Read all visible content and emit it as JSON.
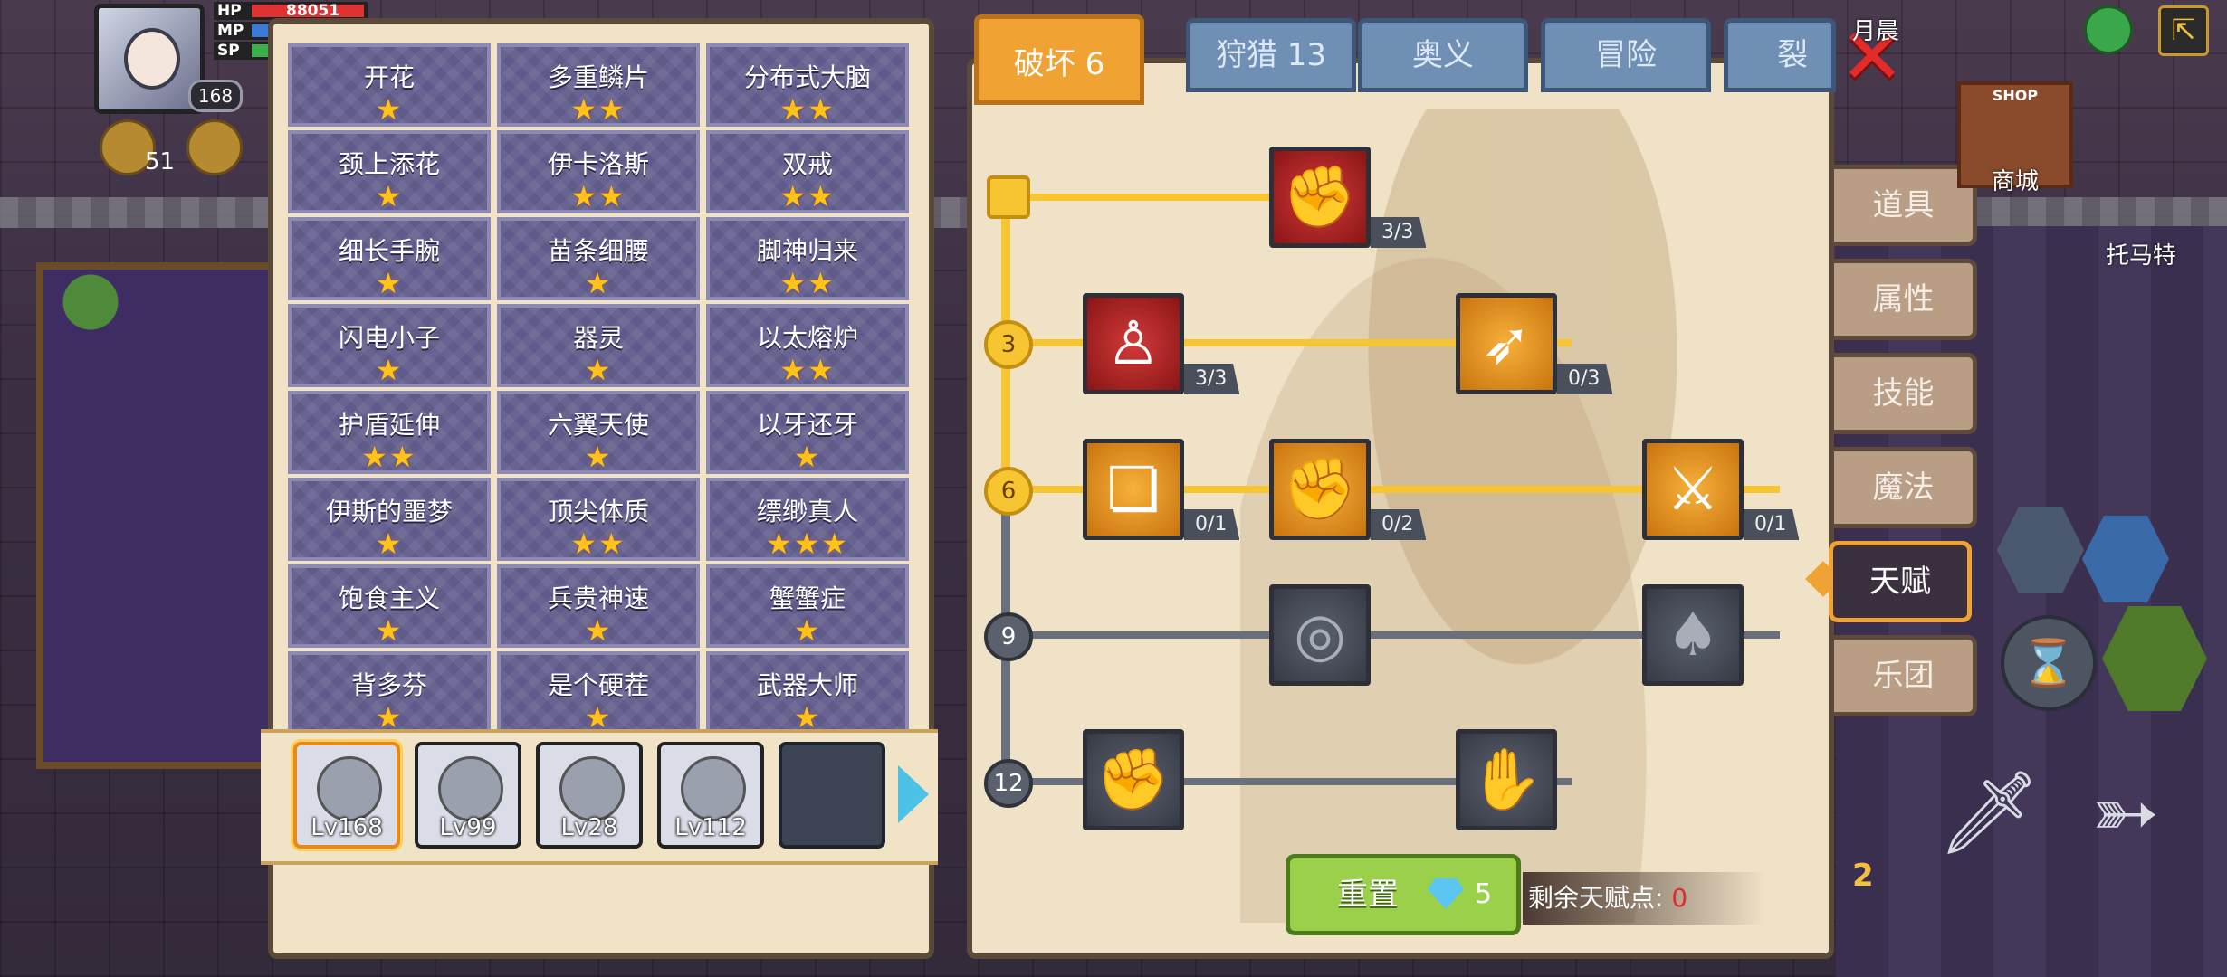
{
  "hud": {
    "hp_label": "HP",
    "hp_value": "88051",
    "mp_label": "MP",
    "sp_label": "SP",
    "level": "168",
    "resource_count": "51"
  },
  "talents": [
    {
      "name": "开花",
      "stars": "★"
    },
    {
      "name": "多重鳞片",
      "stars": "★★"
    },
    {
      "name": "分布式大脑",
      "stars": "★★"
    },
    {
      "name": "颈上添花",
      "stars": "★"
    },
    {
      "name": "伊卡洛斯",
      "stars": "★★"
    },
    {
      "name": "双戒",
      "stars": "★★"
    },
    {
      "name": "细长手腕",
      "stars": "★"
    },
    {
      "name": "苗条细腰",
      "stars": "★"
    },
    {
      "name": "脚神归来",
      "stars": "★★"
    },
    {
      "name": "闪电小子",
      "stars": "★"
    },
    {
      "name": "器灵",
      "stars": "★"
    },
    {
      "name": "以太熔炉",
      "stars": "★★"
    },
    {
      "name": "护盾延伸",
      "stars": "★★"
    },
    {
      "name": "六翼天使",
      "stars": "★"
    },
    {
      "name": "以牙还牙",
      "stars": "★"
    },
    {
      "name": "伊斯的噩梦",
      "stars": "★"
    },
    {
      "name": "顶尖体质",
      "stars": "★★"
    },
    {
      "name": "缥缈真人",
      "stars": "★★★"
    },
    {
      "name": "饱食主义",
      "stars": "★"
    },
    {
      "name": "兵贵神速",
      "stars": "★"
    },
    {
      "name": "蟹蟹症",
      "stars": "★"
    },
    {
      "name": "背多芬",
      "stars": "★"
    },
    {
      "name": "是个硬茬",
      "stars": "★"
    },
    {
      "name": "武器大师",
      "stars": "★"
    }
  ],
  "team": [
    {
      "level": "Lv168"
    },
    {
      "level": "Lv99"
    },
    {
      "level": "Lv28"
    },
    {
      "level": "Lv112"
    },
    {
      "level": ""
    }
  ],
  "tabs": [
    "破坏 6",
    "狩猎 13",
    "奥义",
    "冒险",
    "裂痕"
  ],
  "tree": {
    "tiers": [
      "3",
      "6",
      "9",
      "12"
    ],
    "skills": [
      {
        "count": "3/3",
        "icon": "arm-wrestle-icon"
      },
      {
        "count": "3/3",
        "icon": "muscle-body-icon"
      },
      {
        "count": "0/3",
        "icon": "arrow-strike-icon"
      },
      {
        "count": "0/1",
        "icon": "card-slash-icon"
      },
      {
        "count": "0/2",
        "icon": "punch-icon"
      },
      {
        "count": "0/1",
        "icon": "sword-splash-icon"
      },
      {
        "count": "",
        "icon": "ripple-icon"
      },
      {
        "count": "",
        "icon": "bat-drop-icon"
      },
      {
        "count": "",
        "icon": "fist-icon"
      },
      {
        "count": "",
        "icon": "grab-icon"
      }
    ]
  },
  "side_menu": [
    "道具",
    "属性",
    "技能",
    "魔法",
    "天赋",
    "乐团"
  ],
  "reset": {
    "label": "重置",
    "cost": "5"
  },
  "points": {
    "label": "剩余天赋点:",
    "value": "0"
  },
  "world": {
    "shop_sign": "SHOP",
    "shop_label": "商城",
    "npc_name": "托马特",
    "top_right_text": "月晨",
    "badge_number": "2"
  }
}
